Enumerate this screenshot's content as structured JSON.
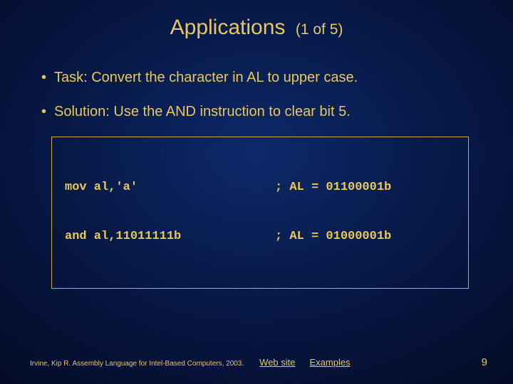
{
  "title": {
    "main": "Applications",
    "sub": "(1 of 5)"
  },
  "bullets": [
    "Task: Convert the character in AL to upper case.",
    "Solution: Use the AND instruction to clear bit 5."
  ],
  "code": {
    "lines": [
      {
        "left": "mov al,'a'",
        "right": "; AL = 01100001b"
      },
      {
        "left": "and al,11011111b",
        "right": "; AL = 01000001b"
      }
    ]
  },
  "footer": {
    "citation": "Irvine, Kip R. Assembly Language for Intel-Based Computers, 2003.",
    "links": {
      "website": "Web site",
      "examples": "Examples"
    },
    "page": "9"
  }
}
